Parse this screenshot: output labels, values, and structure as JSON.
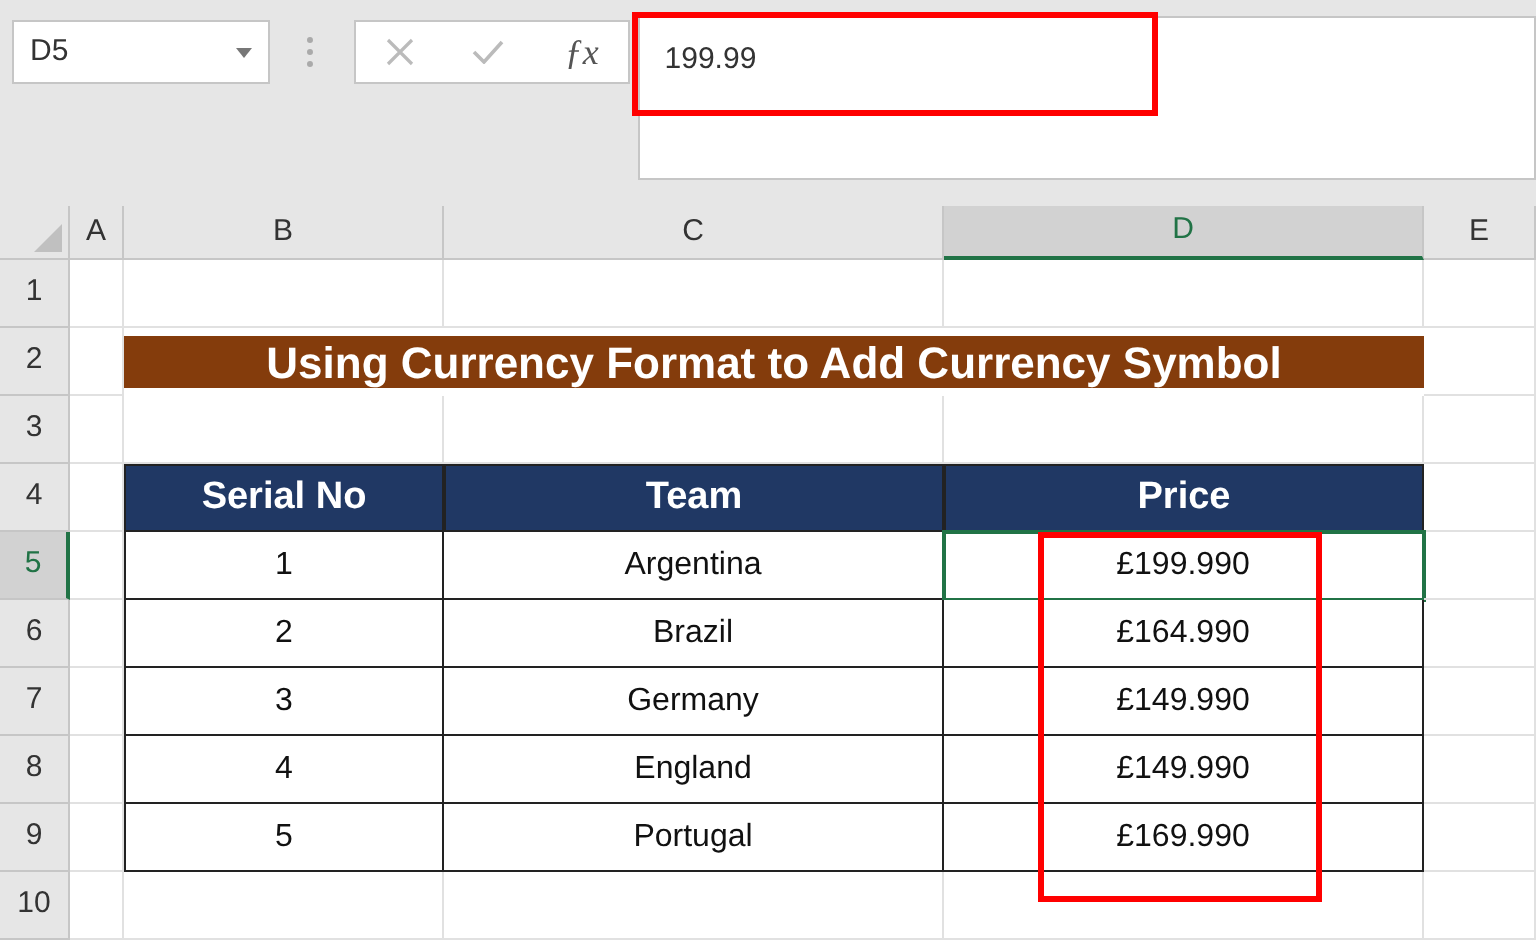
{
  "name_box": "D5",
  "formula_bar": {
    "function_label": "ƒx",
    "value": "199.99",
    "highlighted": true
  },
  "columns": [
    {
      "label": "A",
      "selected": false
    },
    {
      "label": "B",
      "selected": false
    },
    {
      "label": "C",
      "selected": false
    },
    {
      "label": "D",
      "selected": true
    },
    {
      "label": "E",
      "selected": false
    }
  ],
  "rows": [
    {
      "label": "1",
      "selected": false
    },
    {
      "label": "2",
      "selected": false
    },
    {
      "label": "3",
      "selected": false
    },
    {
      "label": "4",
      "selected": false
    },
    {
      "label": "5",
      "selected": true
    },
    {
      "label": "6",
      "selected": false
    },
    {
      "label": "7",
      "selected": false
    },
    {
      "label": "8",
      "selected": false
    },
    {
      "label": "9",
      "selected": false
    },
    {
      "label": "10",
      "selected": false
    }
  ],
  "title": "Using Currency Format to Add Currency Symbol",
  "table": {
    "headers": [
      "Serial No",
      "Team",
      "Price"
    ],
    "rows": [
      {
        "serial": "1",
        "team": "Argentina",
        "price": "£199.990",
        "selected": true
      },
      {
        "serial": "2",
        "team": "Brazil",
        "price": "£164.990",
        "selected": false
      },
      {
        "serial": "3",
        "team": "Germany",
        "price": "£149.990",
        "selected": false
      },
      {
        "serial": "4",
        "team": "England",
        "price": "£149.990",
        "selected": false
      },
      {
        "serial": "5",
        "team": "Portugal",
        "price": "£169.990",
        "selected": false
      }
    ],
    "price_highlighted": true
  }
}
